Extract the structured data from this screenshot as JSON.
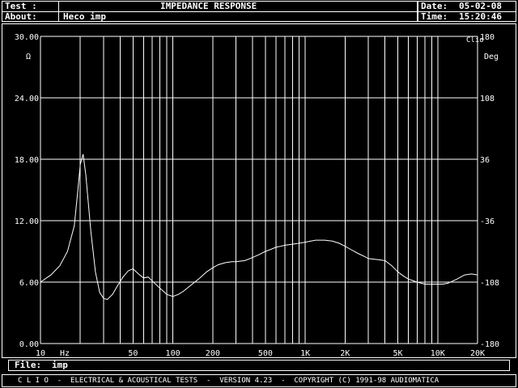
{
  "header": {
    "test_label": "Test :",
    "title": "IMPEDANCE RESPONSE",
    "about_label": "About:",
    "about_value": "Heco imp",
    "date_label": "Date:",
    "date_value": "05-02-08",
    "time_label": "Time:",
    "time_value": "15:20:46"
  },
  "graph": {
    "logo": "Clio",
    "left_unit": "Ω",
    "right_unit": "Deg",
    "curve_color": "#ffffff",
    "background": "#000000"
  },
  "footer": {
    "file_label": "File:",
    "file_value": "imp",
    "status_line": "C L I O  -  ELECTRICAL & ACOUSTICAL TESTS  -  VERSION 4.23  -  COPYRIGHT (C) 1991-98 AUDIOMATICA"
  },
  "chart_data": {
    "type": "line",
    "title": "IMPEDANCE RESPONSE",
    "x_scale": "log",
    "xlim": [
      10,
      20000
    ],
    "x_ticks": [
      10,
      50,
      100,
      200,
      500,
      1000,
      2000,
      5000,
      10000,
      20000
    ],
    "x_tick_labels": [
      "10",
      "50",
      "100",
      "200",
      "500",
      "1K",
      "2K",
      "5K",
      "10K",
      "20K"
    ],
    "x_unit_label": "Hz",
    "ylim": [
      0,
      30
    ],
    "y_ticks": [
      "0.00",
      "6.00",
      "12.00",
      "18.00",
      "24.00",
      "30.00"
    ],
    "y_label": "Ω",
    "y2lim": [
      -180,
      180
    ],
    "y2_ticks": [
      "-180",
      "-108",
      "-36",
      "36",
      "108",
      "180"
    ],
    "y2_label": "Deg",
    "grid": true,
    "series": [
      {
        "x": [
          10,
          12,
          14,
          16,
          18,
          19,
          20,
          21,
          22,
          24,
          26,
          28,
          30,
          32,
          35,
          38,
          42,
          46,
          50,
          55,
          60,
          65,
          70,
          80,
          90,
          100,
          110,
          120,
          140,
          160,
          180,
          200,
          220,
          250,
          280,
          300,
          350,
          400,
          450,
          500,
          550,
          600,
          650,
          700,
          800,
          900,
          1000,
          1100,
          1200,
          1300,
          1400,
          1600,
          1800,
          2000,
          2200,
          2500,
          2800,
          3000,
          3500,
          4000,
          4500,
          5000,
          5500,
          6000,
          7000,
          8000,
          9000,
          10000,
          11000,
          12000,
          14000,
          16000,
          18000,
          20000
        ],
        "y": [
          6.0,
          6.7,
          7.6,
          9.0,
          11.5,
          14.5,
          17.5,
          18.5,
          16.5,
          11.0,
          7.0,
          5.0,
          4.4,
          4.3,
          4.8,
          5.6,
          6.5,
          7.1,
          7.3,
          6.8,
          6.4,
          6.5,
          6.1,
          5.4,
          4.8,
          4.6,
          4.8,
          5.1,
          5.8,
          6.4,
          7.0,
          7.4,
          7.7,
          7.9,
          8.0,
          8.0,
          8.1,
          8.4,
          8.7,
          9.0,
          9.2,
          9.4,
          9.5,
          9.6,
          9.7,
          9.8,
          9.9,
          10.0,
          10.1,
          10.1,
          10.1,
          10.0,
          9.8,
          9.5,
          9.2,
          8.8,
          8.5,
          8.3,
          8.2,
          8.1,
          7.6,
          7.0,
          6.6,
          6.3,
          6.0,
          5.8,
          5.8,
          5.8,
          5.8,
          5.9,
          6.3,
          6.7,
          6.8,
          6.7
        ]
      }
    ]
  }
}
